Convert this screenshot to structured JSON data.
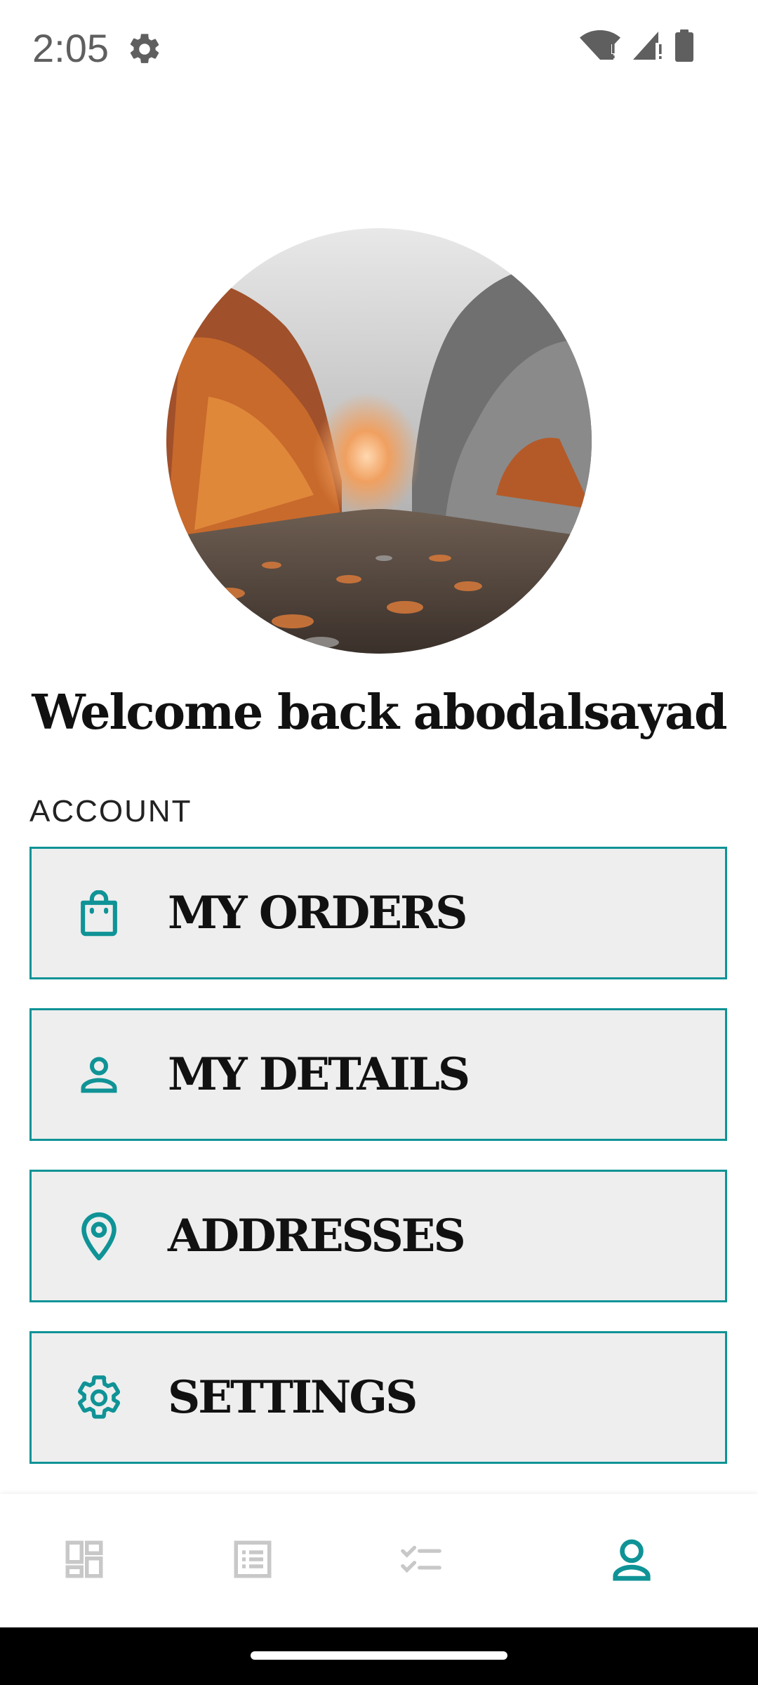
{
  "status_bar": {
    "time": "2:05",
    "icons": [
      "gear-icon",
      "wifi-icon",
      "signal-icon",
      "battery-icon"
    ]
  },
  "profile": {
    "welcome_text": "Welcome back abodalsayad"
  },
  "account": {
    "section_label": "ACCOUNT",
    "items": [
      {
        "label": "MY ORDERS",
        "icon": "shopping-bag-icon"
      },
      {
        "label": "MY DETAILS",
        "icon": "person-icon"
      },
      {
        "label": "ADDRESSES",
        "icon": "location-pin-icon"
      },
      {
        "label": "SETTINGS",
        "icon": "gear-icon"
      }
    ]
  },
  "bottom_nav": {
    "items": [
      {
        "icon": "dashboard-icon",
        "active": false
      },
      {
        "icon": "list-icon",
        "active": false
      },
      {
        "icon": "checklist-icon",
        "active": false
      },
      {
        "icon": "profile-icon",
        "active": true
      }
    ]
  },
  "colors": {
    "accent": "#0f9396",
    "menu_background": "#eeeeee",
    "inactive_icon": "#c8c8c8"
  }
}
